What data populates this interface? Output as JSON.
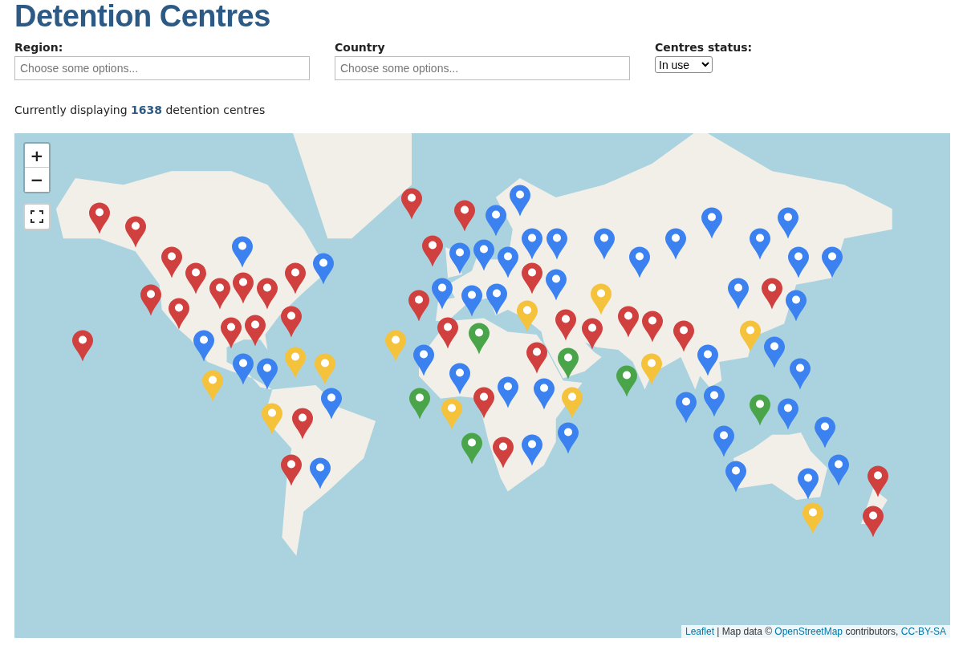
{
  "title": "Detention Centres",
  "filters": [
    {
      "label": "Region:",
      "placeholder": "Choose some options..."
    },
    {
      "label": "Country",
      "placeholder": "Choose some options..."
    }
  ],
  "status": {
    "label": "Centres status:",
    "value": "In use"
  },
  "summary": "Currently displaying **1638** detention centres",
  "map": {
    "zoom_in": "+",
    "zoom_out": "−",
    "markers": [
      {
        "color": "#d0403f"
      },
      {
        "color": "#d0403f"
      },
      {
        "color": "#d0403f"
      },
      {
        "color": "#d0403f"
      },
      {
        "color": "#d0403f"
      },
      {
        "color": "#d0403f"
      },
      {
        "color": "#d0403f"
      },
      {
        "color": "#d0403f"
      },
      {
        "color": "#d0403f"
      },
      {
        "color": "#d0403f"
      },
      {
        "color": "#d0403f"
      },
      {
        "color": "#d0403f"
      },
      {
        "color": "#d0403f"
      },
      {
        "color": "#3b82f0"
      },
      {
        "color": "#3b82f0"
      },
      {
        "color": "#3b82f0"
      },
      {
        "color": "#3b82f0"
      },
      {
        "color": "#3b82f0"
      },
      {
        "color": "#f5c23c"
      },
      {
        "color": "#f5c23c"
      },
      {
        "color": "#d0403f"
      },
      {
        "color": "#f5c23c"
      },
      {
        "color": "#f5c23c"
      },
      {
        "color": "#d0403f"
      },
      {
        "color": "#d0403f"
      },
      {
        "color": "#3b82f0"
      },
      {
        "color": "#3b82f0"
      },
      {
        "color": "#d0403f"
      },
      {
        "color": "#3b82f0"
      },
      {
        "color": "#3b82f0"
      },
      {
        "color": "#3b82f0"
      },
      {
        "color": "#3b82f0"
      },
      {
        "color": "#3b82f0"
      },
      {
        "color": "#3b82f0"
      },
      {
        "color": "#3b82f0"
      },
      {
        "color": "#3b82f0"
      },
      {
        "color": "#3b82f0"
      },
      {
        "color": "#3b82f0"
      },
      {
        "color": "#3b82f0"
      },
      {
        "color": "#d0403f"
      },
      {
        "color": "#d0403f"
      },
      {
        "color": "#d0403f"
      },
      {
        "color": "#4aa54a"
      },
      {
        "color": "#f5c23c"
      },
      {
        "color": "#3b82f0"
      },
      {
        "color": "#3b82f0"
      },
      {
        "color": "#3b82f0"
      },
      {
        "color": "#3b82f0"
      },
      {
        "color": "#3b82f0"
      },
      {
        "color": "#3b82f0"
      },
      {
        "color": "#d0403f"
      },
      {
        "color": "#d0403f"
      },
      {
        "color": "#d0403f"
      },
      {
        "color": "#d0403f"
      },
      {
        "color": "#d0403f"
      },
      {
        "color": "#f5c23c"
      },
      {
        "color": "#f5c23c"
      },
      {
        "color": "#f5c23c"
      },
      {
        "color": "#4aa54a"
      },
      {
        "color": "#4aa54a"
      },
      {
        "color": "#d0403f"
      },
      {
        "color": "#d0403f"
      },
      {
        "color": "#d0403f"
      },
      {
        "color": "#d0403f"
      },
      {
        "color": "#d0403f"
      },
      {
        "color": "#d0403f"
      },
      {
        "color": "#f5c23c"
      },
      {
        "color": "#f5c23c"
      },
      {
        "color": "#f5c23c"
      },
      {
        "color": "#4aa54a"
      },
      {
        "color": "#4aa54a"
      },
      {
        "color": "#4aa54a"
      },
      {
        "color": "#3b82f0"
      },
      {
        "color": "#3b82f0"
      },
      {
        "color": "#3b82f0"
      },
      {
        "color": "#3b82f0"
      },
      {
        "color": "#3b82f0"
      },
      {
        "color": "#3b82f0"
      },
      {
        "color": "#3b82f0"
      },
      {
        "color": "#3b82f0"
      },
      {
        "color": "#3b82f0"
      },
      {
        "color": "#3b82f0"
      },
      {
        "color": "#3b82f0"
      },
      {
        "color": "#3b82f0"
      },
      {
        "color": "#3b82f0"
      },
      {
        "color": "#3b82f0"
      },
      {
        "color": "#3b82f0"
      },
      {
        "color": "#3b82f0"
      },
      {
        "color": "#3b82f0"
      },
      {
        "color": "#3b82f0"
      },
      {
        "color": "#3b82f0"
      },
      {
        "color": "#3b82f0"
      },
      {
        "color": "#3b82f0"
      },
      {
        "color": "#f5c23c"
      },
      {
        "color": "#d0403f"
      },
      {
        "color": "#d0403f"
      }
    ],
    "attribution": [
      {
        "text": "Leaflet",
        "kind": "link"
      },
      {
        "text": " | Map data © ",
        "kind": "text"
      },
      {
        "text": "OpenStreetMap",
        "kind": "link"
      },
      {
        "text": " contributors, ",
        "kind": "text"
      },
      {
        "text": "CC-BY-SA",
        "kind": "link"
      }
    ]
  }
}
